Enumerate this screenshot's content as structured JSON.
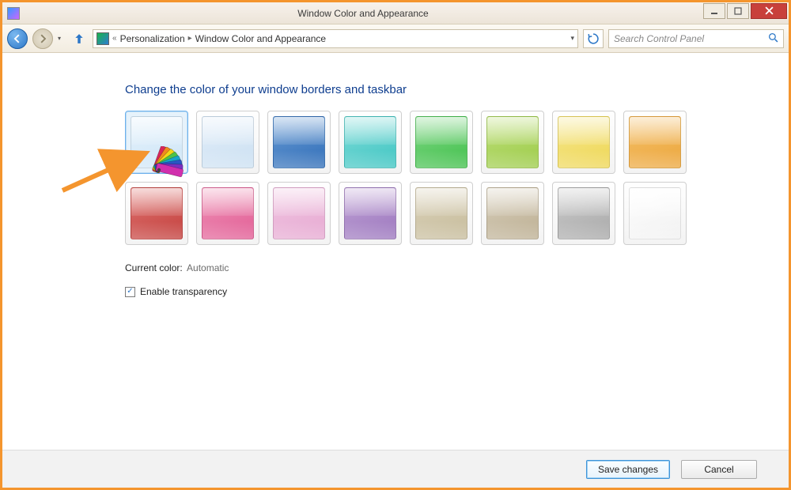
{
  "window": {
    "title": "Window Color and Appearance"
  },
  "breadcrumbs": {
    "item1": "Personalization",
    "item2": "Window Color and Appearance"
  },
  "search": {
    "placeholder": "Search Control Panel"
  },
  "heading": "Change the color of your window borders and taskbar",
  "swatches": [
    {
      "name": "automatic",
      "color1": "#e4f1fb",
      "color2": "#cfe6f7",
      "selected": true
    },
    {
      "name": "frost",
      "color1": "#e3eef9",
      "color2": "#cbe0f2",
      "selected": false
    },
    {
      "name": "blue",
      "color1": "#6e9fd6",
      "color2": "#2e6cb7",
      "selected": false
    },
    {
      "name": "teal",
      "color1": "#87dedb",
      "color2": "#3cc4c1",
      "selected": false
    },
    {
      "name": "green",
      "color1": "#86d98b",
      "color2": "#3fbf49",
      "selected": false
    },
    {
      "name": "lime",
      "color1": "#c0e07e",
      "color2": "#9ccb48",
      "selected": false
    },
    {
      "name": "yellow",
      "color1": "#f6e892",
      "color2": "#eed653",
      "selected": false
    },
    {
      "name": "orange",
      "color1": "#f4c16c",
      "color2": "#eca63c",
      "selected": false
    },
    {
      "name": "red",
      "color1": "#e17a77",
      "color2": "#c23d3a",
      "selected": false
    },
    {
      "name": "magenta",
      "color1": "#f09abb",
      "color2": "#e15a93",
      "selected": false
    },
    {
      "name": "pink",
      "color1": "#f1c8e3",
      "color2": "#e6a8d1",
      "selected": false
    },
    {
      "name": "purple",
      "color1": "#c4a9d8",
      "color2": "#9a74bd",
      "selected": false
    },
    {
      "name": "taupe",
      "color1": "#dcd4bd",
      "color2": "#c6bb9a",
      "selected": false
    },
    {
      "name": "chocolate",
      "color1": "#d9d1bf",
      "color2": "#bcae91",
      "selected": false
    },
    {
      "name": "gray",
      "color1": "#cfcfcf",
      "color2": "#a7a7a7",
      "selected": false
    },
    {
      "name": "white",
      "color1": "#ffffff",
      "color2": "#f1f1f1",
      "selected": false
    }
  ],
  "current": {
    "label": "Current color:",
    "value": "Automatic"
  },
  "transparency": {
    "label": "Enable transparency",
    "checked": true
  },
  "buttons": {
    "save": "Save changes",
    "cancel": "Cancel"
  }
}
